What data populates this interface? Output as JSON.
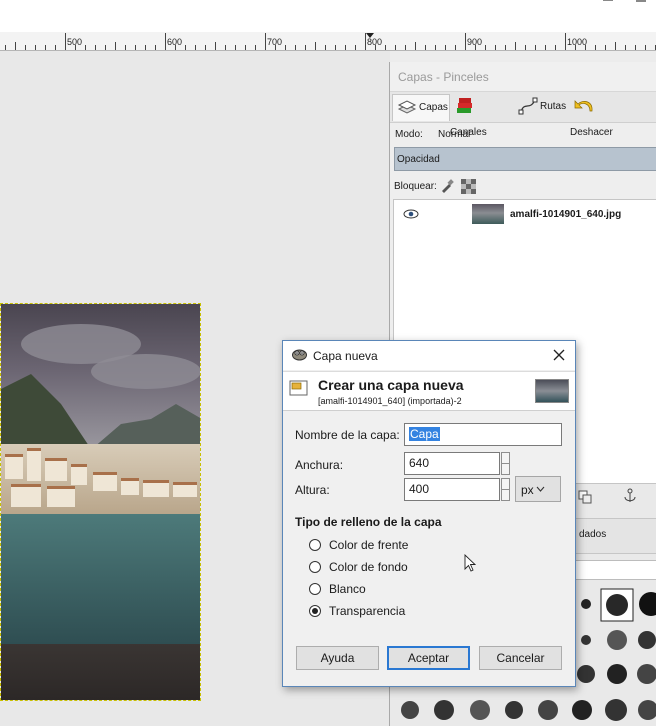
{
  "ruler": {
    "labels": [
      "500",
      "600",
      "700",
      "800",
      "900",
      "1000"
    ]
  },
  "dock": {
    "title": "Capas - Pinceles",
    "tabs": [
      {
        "label": "Capas",
        "icon": "layers-icon"
      },
      {
        "label": "Canales",
        "icon": "channels-icon"
      },
      {
        "label": "Rutas",
        "icon": "paths-icon"
      },
      {
        "label": "Deshacer",
        "icon": "undo-icon"
      }
    ],
    "mode_label": "Modo:",
    "mode_value": "Normal",
    "opacity_label": "Opacidad",
    "lock_label": "Bloquear:",
    "layer_name": "amalfi-1014901_640.jpg",
    "partial_label": "dados"
  },
  "dialog": {
    "title": "Capa nueva",
    "heading": "Crear una capa nueva",
    "subheading": "[amalfi-1014901_640] (importada)-2",
    "name_label": "Nombre de la capa:",
    "name_value": "Capa",
    "width_label": "Anchura:",
    "width_value": "640",
    "height_label": "Altura:",
    "height_value": "400",
    "unit_value": "px",
    "fill_section_title": "Tipo de relleno de la capa",
    "fill_options": [
      {
        "label": "Color de frente",
        "selected": false
      },
      {
        "label": "Color de fondo",
        "selected": false
      },
      {
        "label": "Blanco",
        "selected": false
      },
      {
        "label": "Transparencia",
        "selected": true
      }
    ],
    "help_label": "Ayuda",
    "ok_label": "Aceptar",
    "cancel_label": "Cancelar"
  },
  "colors": {
    "selection_blue": "#cce3f7",
    "accent_blue": "#2a78d2",
    "opacity_bar": "#b7c3cf",
    "selection_border": "#c8c000"
  }
}
